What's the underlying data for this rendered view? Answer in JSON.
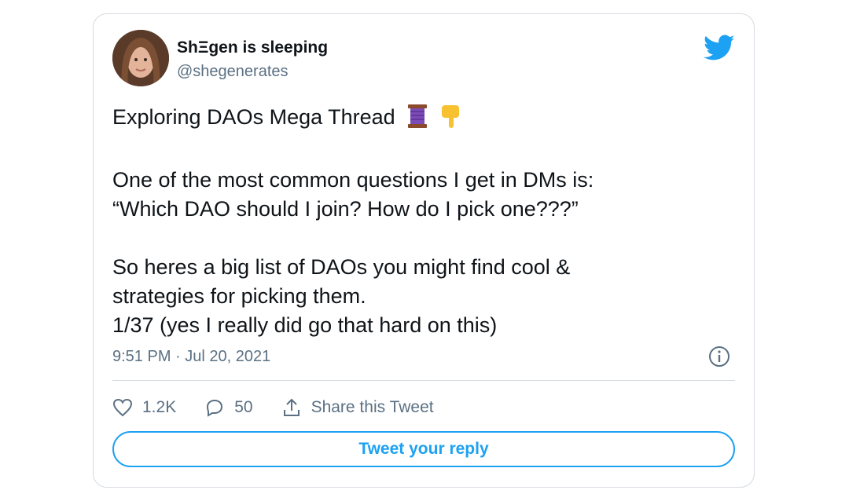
{
  "author": {
    "display_name": "ShΞgen is sleeping",
    "handle": "@shegenerates",
    "avatar_icon": "user-photo"
  },
  "tweet": {
    "lines": [
      "Exploring DAOs Mega Thread",
      "One of the most common questions I get in DMs is:",
      "“Which DAO should I join? How do I pick one???”",
      "So heres a big list of DAOs you might find cool &",
      "strategies for picking them.",
      "1/37 (yes I really did go that hard on this)"
    ],
    "emojis": [
      "thread-spool-icon",
      "pointing-down-icon"
    ],
    "timestamp": "9:51 PM · Jul 20, 2021"
  },
  "actions": {
    "likes": "1.2K",
    "replies": "50",
    "share_label": "Share this Tweet"
  },
  "reply_button": {
    "label": "Tweet your reply"
  },
  "colors": {
    "accent": "#1da1f2",
    "secondary_text": "#5b7083",
    "border": "#d6dbe0"
  }
}
